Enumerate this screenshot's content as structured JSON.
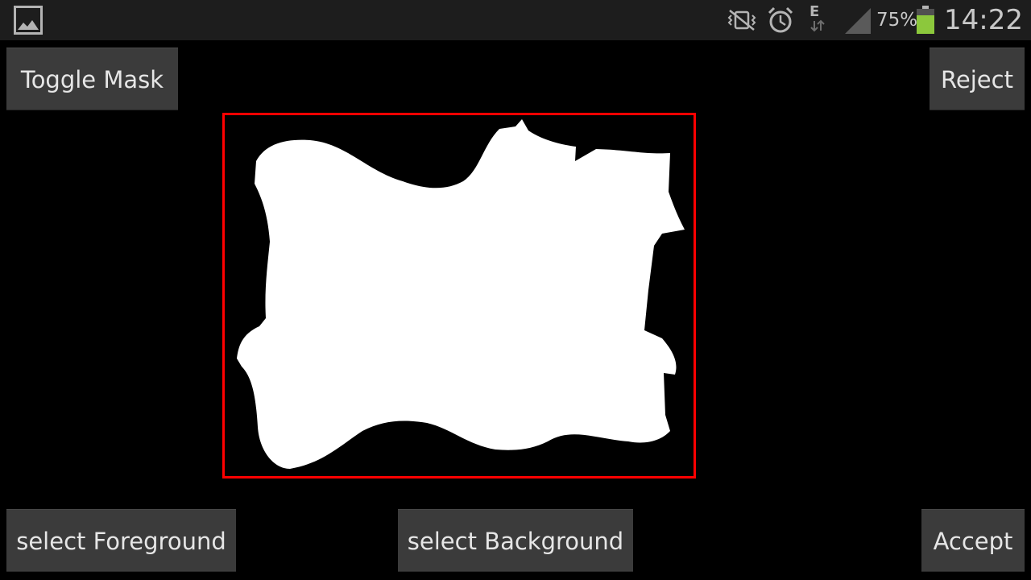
{
  "status_bar": {
    "icons": [
      "gallery-icon",
      "vibrate-mute-icon",
      "alarm-icon",
      "edge-data-icon",
      "signal-icon",
      "battery-icon"
    ],
    "network_label": "E",
    "battery_percent": "75%",
    "battery_level": 0.75,
    "battery_color": "#8cc83c",
    "time": "14:22"
  },
  "buttons": {
    "toggle_mask": "Toggle Mask",
    "reject": "Reject",
    "select_foreground": "select Foreground",
    "select_background": "select Background",
    "accept": "Accept"
  },
  "canvas": {
    "selection_color": "#ff0000",
    "mask_color": "#ffffff",
    "background_color": "#000000"
  }
}
